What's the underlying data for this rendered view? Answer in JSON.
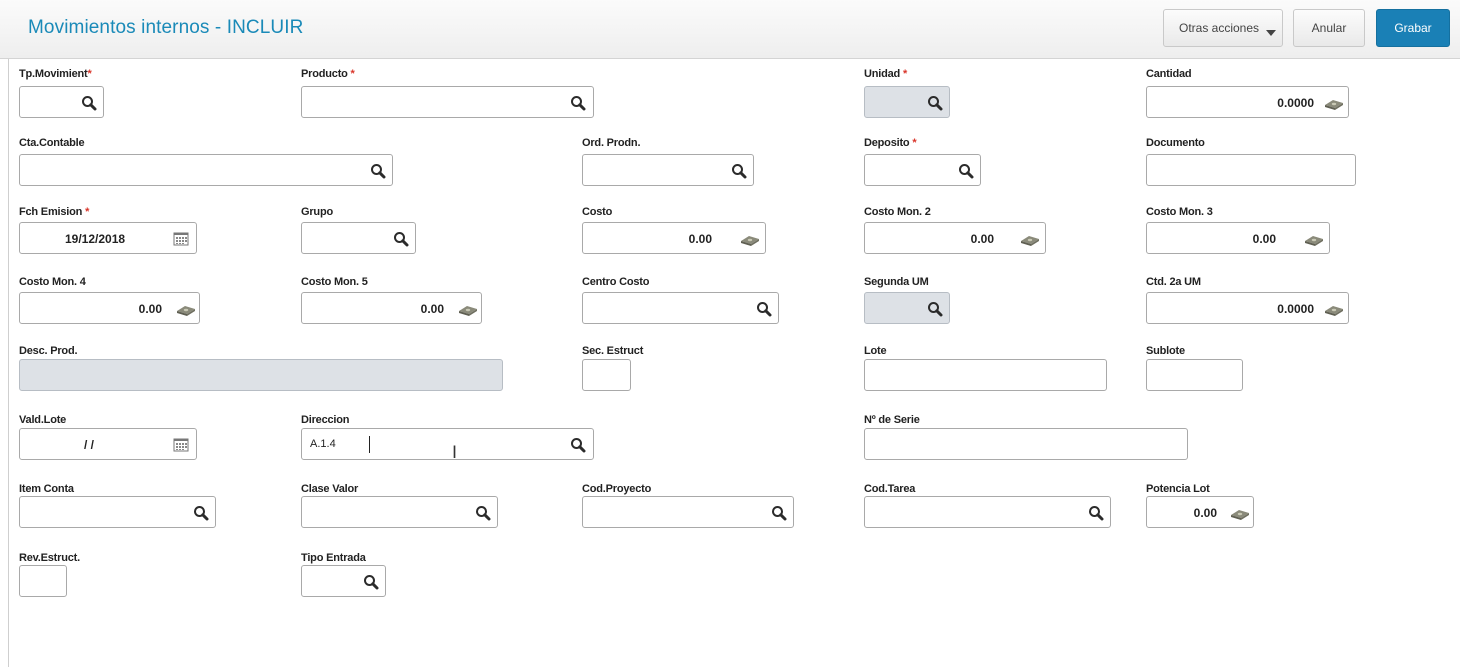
{
  "header": {
    "title": "Movimientos internos - INCLUIR",
    "buttons": {
      "otras": "Otras acciones",
      "anular": "Anular",
      "grabar": "Grabar"
    }
  },
  "form": {
    "tp_movimiento": {
      "label": "Tp.Movimient",
      "required": "*",
      "value": ""
    },
    "producto": {
      "label": "Producto",
      "required": "*",
      "value": ""
    },
    "unidad": {
      "label": "Unidad",
      "required": "*",
      "value": ""
    },
    "cantidad": {
      "label": "Cantidad",
      "value": "0.0000"
    },
    "cta_contable": {
      "label": "Cta.Contable",
      "value": ""
    },
    "ord_prodn": {
      "label": "Ord. Prodn.",
      "value": ""
    },
    "deposito": {
      "label": "Deposito",
      "required": "*",
      "value": ""
    },
    "documento": {
      "label": "Documento",
      "value": ""
    },
    "fch_emision": {
      "label": "Fch Emision",
      "required": "*",
      "value": "19/12/2018"
    },
    "grupo": {
      "label": "Grupo",
      "value": ""
    },
    "costo": {
      "label": "Costo",
      "value": "0.00"
    },
    "costo_mon2": {
      "label": "Costo Mon. 2",
      "value": "0.00"
    },
    "costo_mon3": {
      "label": "Costo Mon. 3",
      "value": "0.00"
    },
    "costo_mon4": {
      "label": "Costo Mon. 4",
      "value": "0.00"
    },
    "costo_mon5": {
      "label": "Costo Mon. 5",
      "value": "0.00"
    },
    "centro_costo": {
      "label": "Centro Costo",
      "value": ""
    },
    "segunda_um": {
      "label": "Segunda UM",
      "value": ""
    },
    "ctd_2a_um": {
      "label": "Ctd. 2a UM",
      "value": "0.0000"
    },
    "desc_prod": {
      "label": "Desc. Prod.",
      "value": ""
    },
    "sec_estruct": {
      "label": "Sec. Estruct",
      "value": ""
    },
    "lote": {
      "label": "Lote",
      "value": ""
    },
    "sublote": {
      "label": "Sublote",
      "value": ""
    },
    "vald_lote": {
      "label": "Vald.Lote",
      "value": "/ /"
    },
    "direccion": {
      "label": "Direccion",
      "value": "A.1.4"
    },
    "n_serie": {
      "label": "Nº de Serie",
      "value": ""
    },
    "item_conta": {
      "label": "Item Conta",
      "value": ""
    },
    "clase_valor": {
      "label": "Clase Valor",
      "value": ""
    },
    "cod_proyecto": {
      "label": "Cod.Proyecto",
      "value": ""
    },
    "cod_tarea": {
      "label": "Cod.Tarea",
      "value": ""
    },
    "potencia_lot": {
      "label": "Potencia Lot",
      "value": "0.00"
    },
    "rev_estruct": {
      "label": "Rev.Estruct.",
      "value": ""
    },
    "tipo_entrada": {
      "label": "Tipo Entrada",
      "value": ""
    }
  },
  "icons": {
    "search": "search-icon",
    "money": "money-icon",
    "calendar": "calendar-icon",
    "dropdown": "chevron-down-icon"
  },
  "colors": {
    "accent": "#1a8ab8",
    "primary_button": "#1a80b6",
    "required": "#d9352a",
    "disabled_field": "#dde1e6"
  }
}
